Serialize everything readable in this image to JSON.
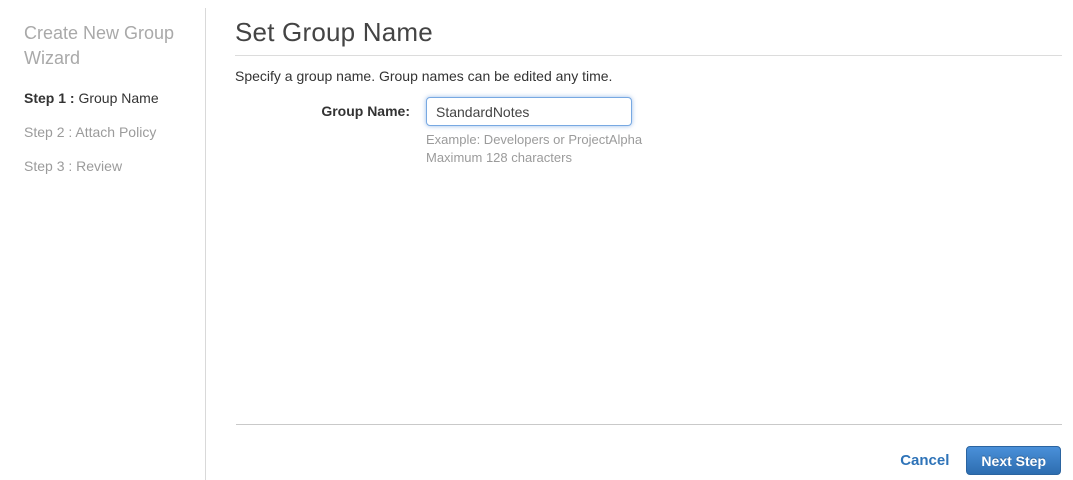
{
  "wizard": {
    "title": "Create New Group Wizard",
    "steps": [
      {
        "prefix": "Step 1 :",
        "label": "Group Name"
      },
      {
        "prefix": "Step 2 :",
        "label": "Attach Policy"
      },
      {
        "prefix": "Step 3 :",
        "label": "Review"
      }
    ],
    "active_step_index": 0
  },
  "main": {
    "heading": "Set Group Name",
    "description": "Specify a group name. Group names can be edited any time.",
    "form": {
      "label": "Group Name:",
      "input_value": "StandardNotes",
      "helper_line1": "Example: Developers or ProjectAlpha",
      "helper_line2": "Maximum 128 characters"
    }
  },
  "footer": {
    "cancel_label": "Cancel",
    "next_label": "Next Step"
  },
  "colors": {
    "accent_blue": "#2e73b8",
    "button_gradient_top": "#4a90d9",
    "button_gradient_bottom": "#2d6db0",
    "button_border": "#2b64a0",
    "input_focus_border": "#78a9e2",
    "muted_text": "#9b9b9b",
    "sidebar_title_text": "#a9a9a9",
    "dark_text": "#333333",
    "heading_text": "#444444",
    "divider": "#d9d9d9"
  }
}
